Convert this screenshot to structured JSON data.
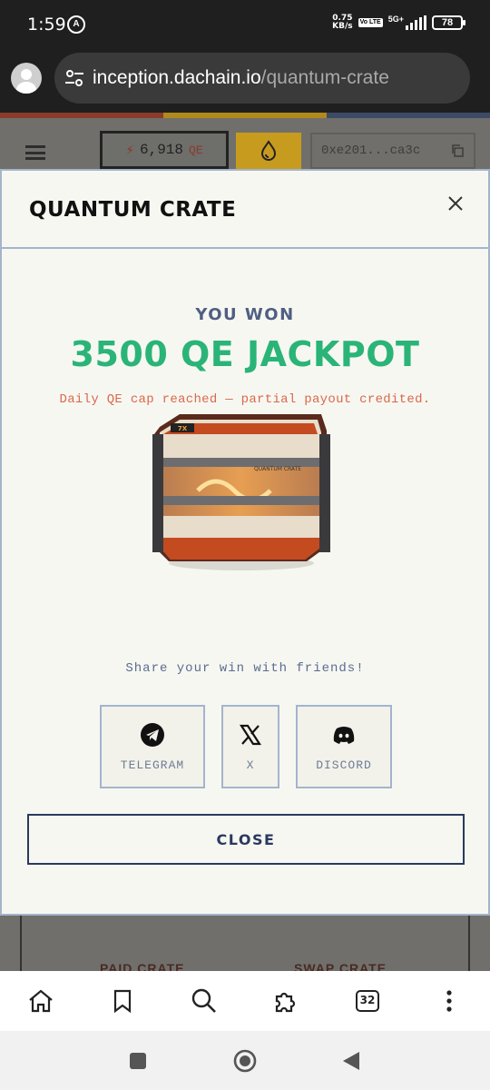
{
  "status": {
    "time": "1:59",
    "net_speed_value": "0.75",
    "net_speed_unit": "KB/s",
    "volte": "Vo LTE",
    "network": "5G+",
    "battery": "78"
  },
  "browser": {
    "domain": "inception.dachain.io",
    "path": "/quantum-crate"
  },
  "header": {
    "balance_value": "6,918",
    "balance_unit": "QE",
    "wallet": "0xe201...ca3c"
  },
  "background_cards": {
    "left_label": "PAID CRATE",
    "right_label": "SWAP CRATE"
  },
  "modal": {
    "title": "QUANTUM CRATE",
    "result_heading": "YOU WON",
    "prize": "3500 QE JACKPOT",
    "cap_note": "Daily QE cap reached — partial payout credited.",
    "crate_label": "QUANTUM CRATE",
    "share_prompt": "Share your win with friends!",
    "share_buttons": [
      {
        "label": "TELEGRAM",
        "icon": "telegram-icon"
      },
      {
        "label": "X",
        "icon": "x-icon"
      },
      {
        "label": "DISCORD",
        "icon": "discord-icon"
      }
    ],
    "close_label": "CLOSE"
  },
  "browser_nav": {
    "tab_count": "32",
    "items": [
      "home-icon",
      "bookmark-icon",
      "search-icon",
      "extensions-icon",
      "tabs-icon",
      "more-icon"
    ]
  },
  "colors": {
    "accent_green": "#2ab478",
    "heading_blue": "#4f5f82",
    "warning_orange": "#d9694a",
    "border_blue": "#a4b4cc",
    "dark_navy": "#2a3a5e"
  }
}
